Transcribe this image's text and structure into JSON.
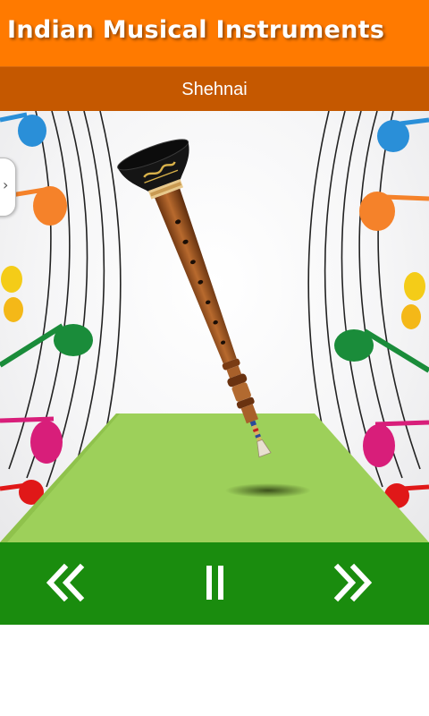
{
  "app": {
    "title": "Indian Musical Instruments"
  },
  "instrument": {
    "name": "Shehnai"
  },
  "controls": {
    "previous_icon": "double-chevron-left-icon",
    "pause_icon": "pause-icon",
    "next_icon": "double-chevron-right-icon"
  },
  "colors": {
    "header": "#ff7a00",
    "subbar": "#c55800",
    "controls_bar": "#1a8c0e",
    "platform": "#9dd05a"
  }
}
